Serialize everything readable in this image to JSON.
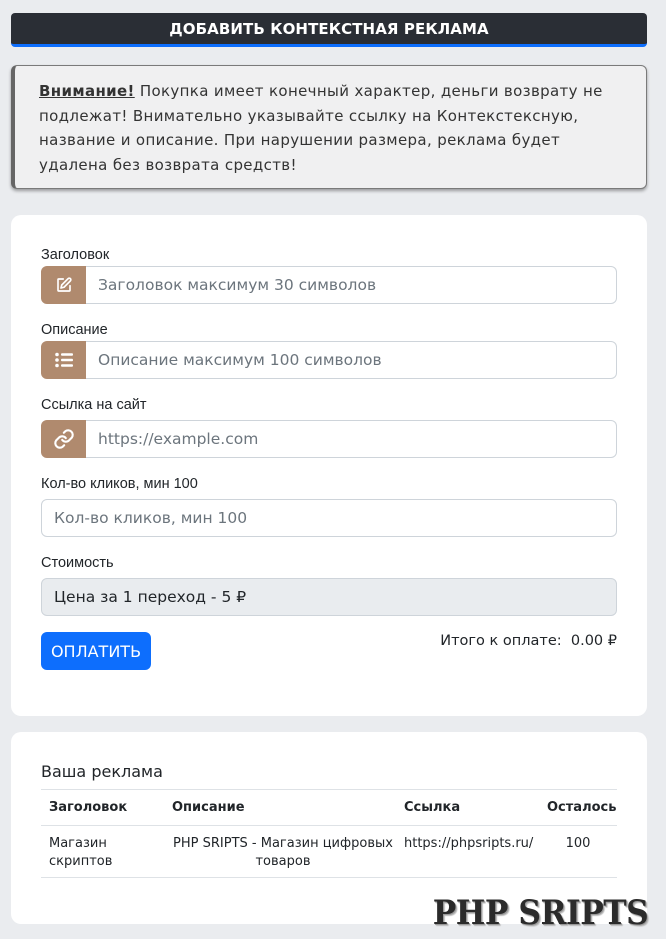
{
  "header": {
    "title": "ДОБАВИТЬ КОНТЕКСТНАЯ РЕКЛАМА"
  },
  "warning": {
    "strong": "Внимание!",
    "text": " Покупка имеет конечный характер, деньги возврату не подлежат! Внимательно указывайте ссылку на Контекстексную, название и описание. При нарушении размера, реклама будет удалена без возврата средств!"
  },
  "form": {
    "title_label": "Заголовок",
    "title_placeholder": "Заголовок максимум 30 символов",
    "title_icon": "edit-icon",
    "desc_label": "Описание",
    "desc_placeholder": "Описание максимум 100 символов",
    "desc_icon": "list-icon",
    "link_label": "Ссылка на сайт",
    "link_placeholder": "https://example.com",
    "link_icon": "link-icon",
    "clicks_label": "Кол-во кликов, мин 100",
    "clicks_placeholder": "Кол-во кликов, мин 100",
    "cost_label": "Стоимость",
    "cost_value": "Цена за 1 переход - 5 ₽",
    "pay_button": "ОПЛАТИТЬ",
    "total_label": "Итого к оплате:",
    "total_value": "0.00 ₽",
    "accent_color": "#b08a6e"
  },
  "ads": {
    "title": "Ваша реклама",
    "columns": [
      "Заголовок",
      "Описание",
      "Ссылка",
      "Осталось"
    ],
    "rows": [
      {
        "title_line1": "Магазин",
        "title_line2": "скриптов",
        "desc_line1": "PHP SRIPTS - Магазин цифровых",
        "desc_line2": "товаров",
        "link": "https://phpsripts.ru/",
        "remaining": "100"
      }
    ]
  },
  "watermark": "PHP SRIPTS"
}
